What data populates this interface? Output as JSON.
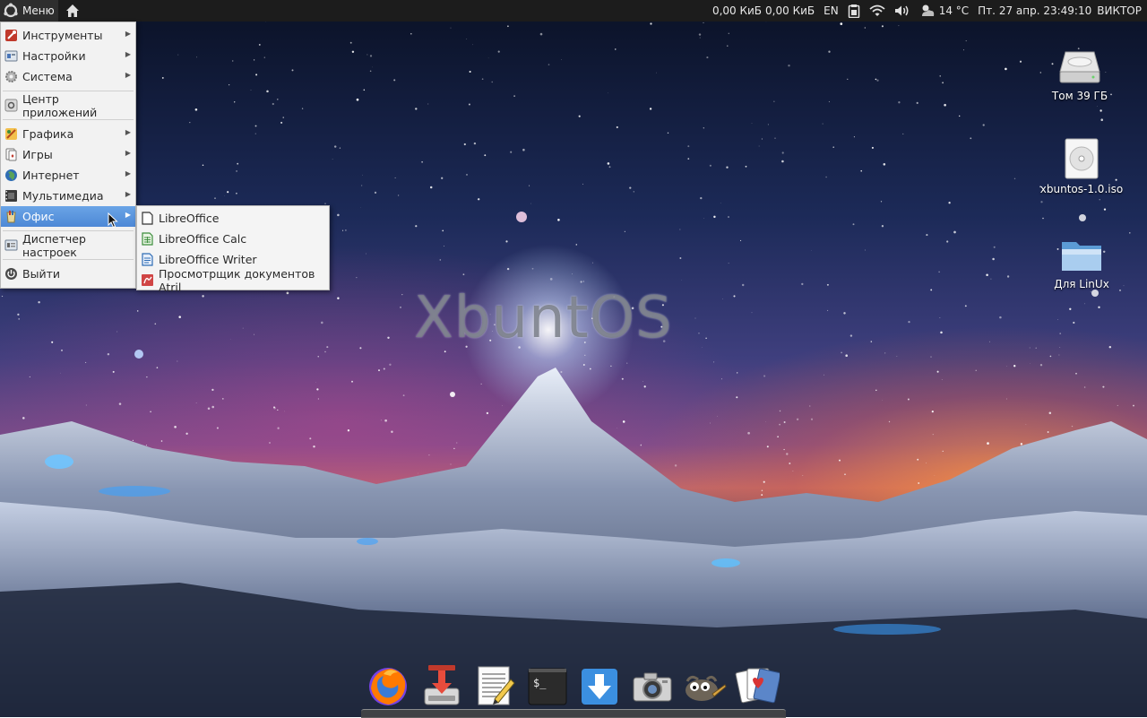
{
  "panel": {
    "menu_label": "Меню",
    "net_down": "0,00 КиБ",
    "net_up": "0,00 КиБ",
    "keyboard_layout": "EN",
    "weather": "14 °C",
    "datetime": "Пт.  27 апр. 23:49:10",
    "user": "ВИКТОР"
  },
  "watermark": "XbuntOS",
  "desktop_icons": [
    {
      "label": "Том 39 ГБ",
      "icon": "hard-drive-icon"
    },
    {
      "label": "xbuntos-1.0.iso",
      "icon": "disc-image-icon"
    },
    {
      "label": "Для LinUx",
      "icon": "folder-icon"
    }
  ],
  "menu": {
    "items": [
      {
        "label": "Инструменты",
        "icon": "tools-icon",
        "submenu": true
      },
      {
        "label": "Настройки",
        "icon": "settings-icon",
        "submenu": true
      },
      {
        "label": "Система",
        "icon": "system-gear-icon",
        "submenu": true
      },
      {
        "label": "Центр приложений",
        "icon": "app-center-icon",
        "submenu": false
      },
      {
        "label": "Графика",
        "icon": "graphics-icon",
        "submenu": true
      },
      {
        "label": "Игры",
        "icon": "games-icon",
        "submenu": true
      },
      {
        "label": "Интернет",
        "icon": "internet-globe-icon",
        "submenu": true
      },
      {
        "label": "Мультимедиа",
        "icon": "multimedia-icon",
        "submenu": true
      },
      {
        "label": "Офис",
        "icon": "office-icon",
        "submenu": true,
        "active": true
      },
      {
        "label": "Диспетчер настроек",
        "icon": "settings-manager-icon",
        "submenu": false
      },
      {
        "label": "Выйти",
        "icon": "power-icon",
        "submenu": false
      }
    ]
  },
  "office_submenu": {
    "items": [
      {
        "label": "LibreOffice",
        "icon": "libreoffice-icon"
      },
      {
        "label": "LibreOffice Calc",
        "icon": "libreoffice-calc-icon"
      },
      {
        "label": "LibreOffice Writer",
        "icon": "libreoffice-writer-icon"
      },
      {
        "label": "Просмотрщик документов Atril",
        "icon": "atril-viewer-icon"
      }
    ]
  },
  "dock": [
    {
      "icon": "firefox-icon"
    },
    {
      "icon": "transmission-icon"
    },
    {
      "icon": "text-editor-icon"
    },
    {
      "icon": "terminal-icon",
      "glyph": "$_"
    },
    {
      "icon": "download-icon"
    },
    {
      "icon": "screenshot-camera-icon"
    },
    {
      "icon": "gimp-icon"
    },
    {
      "icon": "solitaire-cards-icon"
    }
  ],
  "colors": {
    "panel_bg": "#1c1c1c",
    "menu_active": "#4d88d6",
    "menu_bg": "#f2f2f2"
  }
}
